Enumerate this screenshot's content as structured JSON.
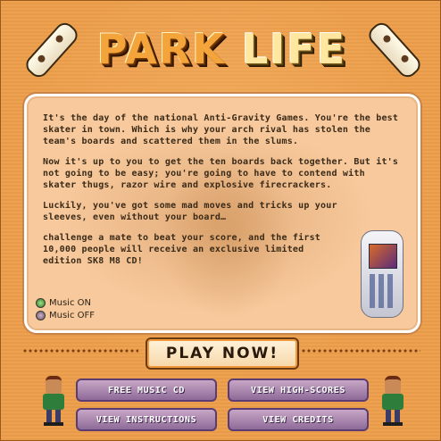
{
  "title": {
    "word1": "PARK",
    "word2": "LIFE"
  },
  "story": {
    "paragraphs": [
      "It's the day of the national Anti-Gravity Games. You're the best skater in town. Which is why your arch rival has stolen the team's boards and scattered them in the slums.",
      "Now it's up to you to get the ten boards back together. But it's not going to be easy; you're going to have to contend with skater thugs, razor wire and explosive firecrackers.",
      "Luckily, you've got some mad moves and tricks up your sleeves, even without your board…",
      "challenge a mate to beat your score, and the first 10,000 people will receive an exclusive limited edition SK8 M8 CD!"
    ]
  },
  "music": {
    "on_label": "Music ON",
    "off_label": "Music OFF"
  },
  "buttons": {
    "play": "PLAY NOW!",
    "free_music": "FREE MUSIC CD",
    "high_scores": "VIEW HIGH-SCORES",
    "instructions": "VIEW INSTRUCTIONS",
    "credits": "VIEW CREDITS"
  },
  "colors": {
    "background": "#eea04c",
    "panel": "#f7c99c",
    "menu_button": "#a783ae",
    "play_button": "#fff3dc"
  },
  "icons": [
    "skateboard-icon",
    "mobile-phone-icon",
    "skater-character-icon",
    "radio-icon"
  ]
}
